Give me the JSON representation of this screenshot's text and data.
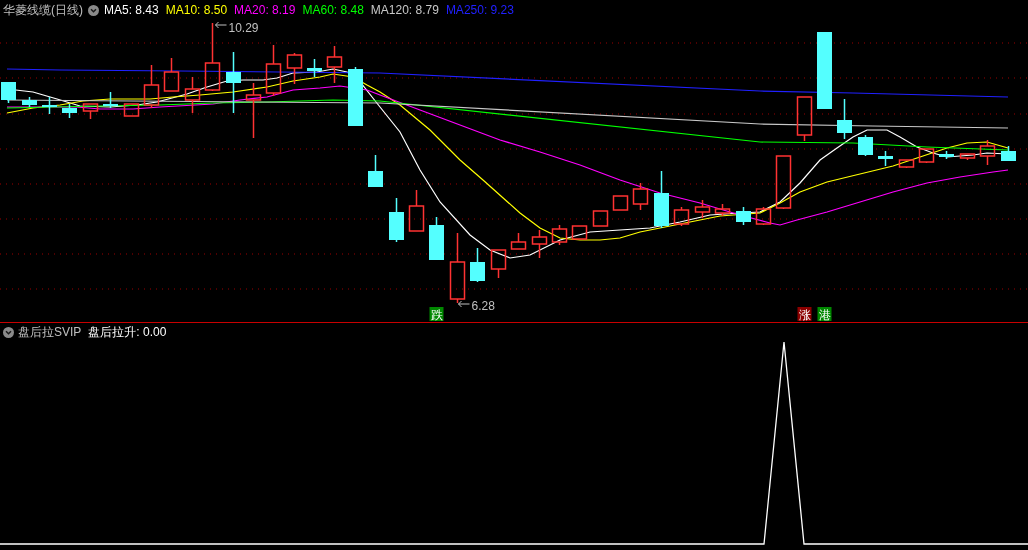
{
  "chart_title": "华菱线缆(日线)",
  "ma_legend": [
    {
      "text": "MA5: 8.43",
      "color": "#ffffff"
    },
    {
      "text": "MA10: 8.50",
      "color": "#ffff00"
    },
    {
      "text": "MA20: 8.19",
      "color": "#ff00ff"
    },
    {
      "text": "MA60: 8.48",
      "color": "#00ff00"
    },
    {
      "text": "MA120: 8.79",
      "color": "#c8c8c8"
    },
    {
      "text": "MA250: 9.23",
      "color": "#2020ff"
    }
  ],
  "price_labels": [
    {
      "kind": "high",
      "text": "10.29"
    },
    {
      "kind": "low",
      "text": "6.28"
    }
  ],
  "signal_badges": [
    {
      "text": "跌",
      "color": "#008800"
    },
    {
      "text": "涨",
      "color": "#8c0000"
    },
    {
      "text": "港",
      "color": "#008800"
    }
  ],
  "indicator_panel": {
    "title": "盘后拉SVIP",
    "reading": "盘后拉升: 0.00"
  }
}
